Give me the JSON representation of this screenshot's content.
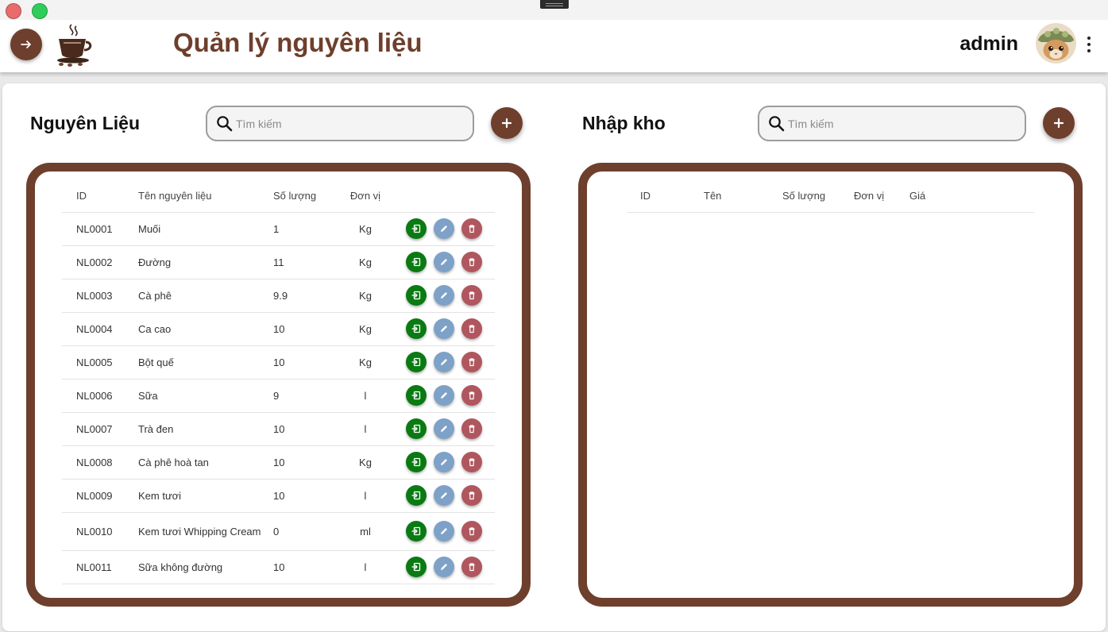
{
  "window": {
    "controls": [
      "close",
      "maximize"
    ]
  },
  "header": {
    "title": "Quản lý nguyên liệu",
    "user": "admin",
    "nav_icon": "arrow-right-icon",
    "menu_icon": "more-vertical-icon"
  },
  "ingredients": {
    "title": "Nguyên Liệu",
    "search_placeholder": "Tìm kiếm",
    "columns": {
      "id": "ID",
      "name": "Tên nguyên liệu",
      "quantity": "Số lượng",
      "unit": "Đơn vị"
    },
    "rows": [
      {
        "id": "NL0001",
        "name": "Muối",
        "quantity": "1",
        "unit": "Kg"
      },
      {
        "id": "NL0002",
        "name": "Đường",
        "quantity": "11",
        "unit": "Kg"
      },
      {
        "id": "NL0003",
        "name": "Cà phê",
        "quantity": "9.9",
        "unit": "Kg"
      },
      {
        "id": "NL0004",
        "name": "Ca cao",
        "quantity": "10",
        "unit": "Kg"
      },
      {
        "id": "NL0005",
        "name": "Bột quế",
        "quantity": "10",
        "unit": "Kg"
      },
      {
        "id": "NL0006",
        "name": "Sữa",
        "quantity": "9",
        "unit": "l"
      },
      {
        "id": "NL0007",
        "name": "Trà đen",
        "quantity": "10",
        "unit": "l"
      },
      {
        "id": "NL0008",
        "name": "Cà phê hoà tan",
        "quantity": "10",
        "unit": "Kg"
      },
      {
        "id": "NL0009",
        "name": "Kem tươi",
        "quantity": "10",
        "unit": "l"
      },
      {
        "id": "NL0010",
        "name": "Kem tươi Whipping Cream",
        "quantity": "0",
        "unit": "ml"
      },
      {
        "id": "NL0011",
        "name": "Sữa không đường",
        "quantity": "10",
        "unit": "l"
      }
    ]
  },
  "stock_import": {
    "title": "Nhập kho",
    "search_placeholder": "Tìm kiếm",
    "columns": {
      "id": "ID",
      "name": "Tên",
      "quantity": "Số lượng",
      "unit": "Đơn vị",
      "price": "Giá"
    },
    "rows": []
  },
  "colors": {
    "brand": "#6e3f2c",
    "import_action": "#0a7a12",
    "edit_action": "#7ea1c8",
    "delete_action": "#b0565e"
  }
}
